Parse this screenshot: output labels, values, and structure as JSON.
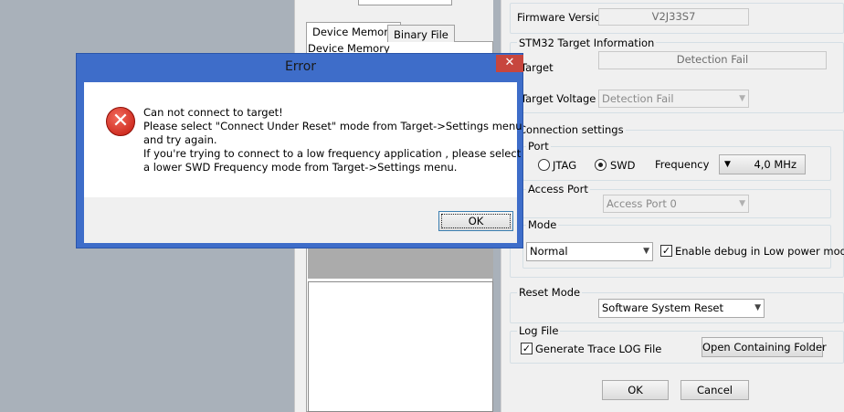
{
  "middle": {
    "tabs": [
      "Device Memory",
      "Binary File"
    ],
    "content_label": "Device Memory"
  },
  "settings": {
    "firmware_label": "Firmware Version",
    "firmware_value": "V2J33S7",
    "stm32_group": "STM32 Target Information",
    "target_label": "Target",
    "target_value": "Detection Fail",
    "voltage_label": "Target Voltage",
    "voltage_value": "Detection Fail",
    "connection_group": "Connection settings",
    "port_group": "Port",
    "jtag_label": "JTAG",
    "swd_label": "SWD",
    "frequency_label": "Frequency",
    "frequency_value": "4,0 MHz",
    "access_port_group": "Access Port",
    "access_port_value": "Access Port 0",
    "mode_group": "Mode",
    "mode_value": "Normal",
    "debug_low_power_label": "Enable debug in Low power mode",
    "reset_mode_group": "Reset Mode",
    "reset_mode_value": "Software System Reset",
    "log_file_group": "Log File",
    "generate_log_label": "Generate Trace LOG File",
    "open_folder_label": "Open Containing Folder",
    "ok_label": "OK",
    "cancel_label": "Cancel"
  },
  "dialog": {
    "title": "Error",
    "close_glyph": "✕",
    "icon": "error-icon",
    "lines": [
      "Can not connect to target!",
      "Please select \"Connect Under Reset\" mode from Target->Settings menu",
      "and try again.",
      "If you're trying to connect to a low frequency application , please select",
      "a lower SWD Frequency mode from Target->Settings menu."
    ],
    "ok_label": "OK"
  }
}
